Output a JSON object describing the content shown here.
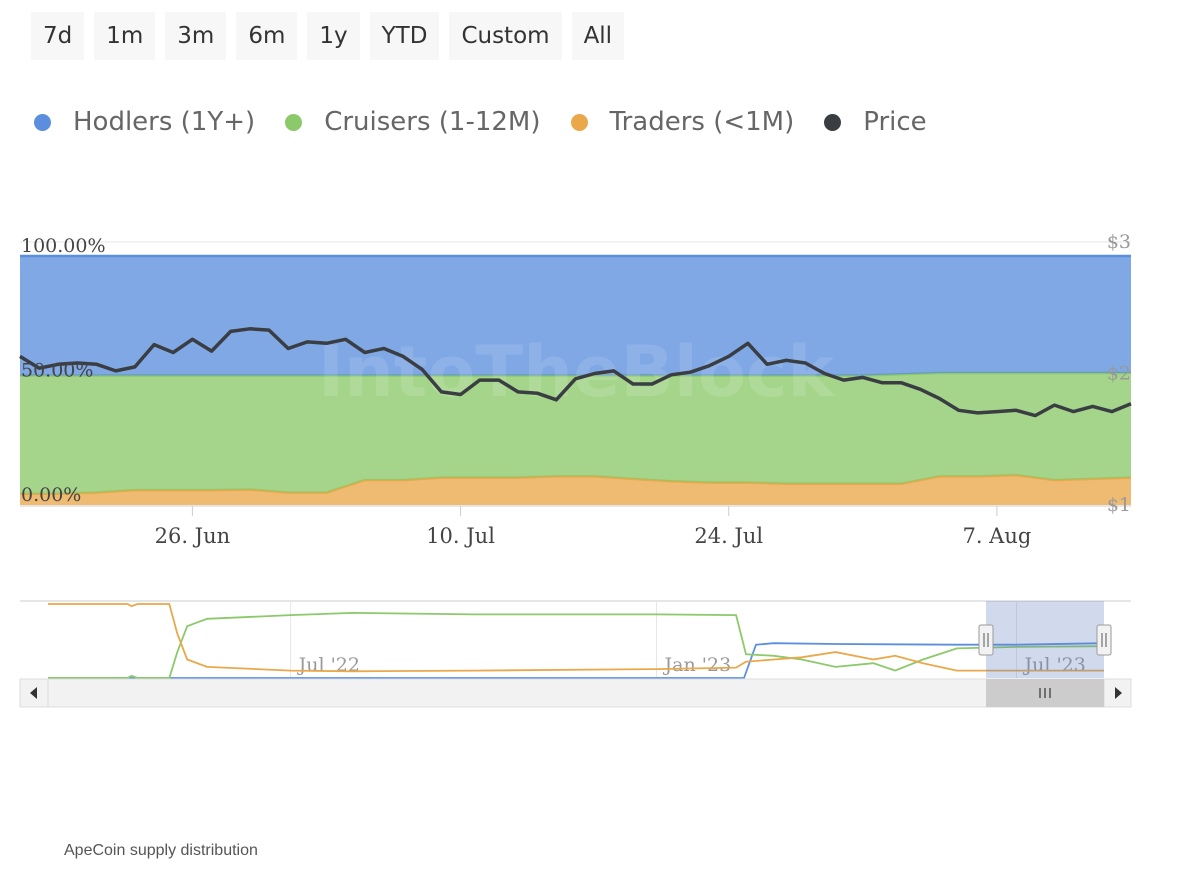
{
  "range_selector": {
    "buttons": [
      "7d",
      "1m",
      "3m",
      "6m",
      "1y",
      "YTD",
      "Custom",
      "All"
    ]
  },
  "legend": [
    {
      "label": "Hodlers (1Y+)",
      "color": "#5b8fde"
    },
    {
      "label": "Cruisers (1-12M)",
      "color": "#8cc96a"
    },
    {
      "label": "Traders (<1M)",
      "color": "#eaa84a"
    },
    {
      "label": "Price",
      "color": "#3a3d42"
    }
  ],
  "caption": "ApeCoin supply distribution",
  "chart_data": {
    "type": "area",
    "stacked_percent": true,
    "x": [
      "2023-06-17",
      "2023-06-19",
      "2023-06-21",
      "2023-06-23",
      "2023-06-25",
      "2023-06-27",
      "2023-06-29",
      "2023-07-01",
      "2023-07-03",
      "2023-07-05",
      "2023-07-07",
      "2023-07-09",
      "2023-07-11",
      "2023-07-13",
      "2023-07-15",
      "2023-07-17",
      "2023-07-19",
      "2023-07-21",
      "2023-07-23",
      "2023-07-25",
      "2023-07-27",
      "2023-07-29",
      "2023-07-31",
      "2023-08-02",
      "2023-08-04",
      "2023-08-06",
      "2023-08-08",
      "2023-08-10",
      "2023-08-12",
      "2023-08-14"
    ],
    "series": [
      {
        "name": "Traders (<1M)",
        "values": [
          4.5,
          4.5,
          5,
          6,
          6,
          6,
          6.2,
          5,
          5,
          10,
          10,
          11,
          11,
          11,
          11.5,
          11.5,
          10.5,
          9.5,
          9,
          9,
          8.5,
          8.5,
          8.5,
          8.5,
          11.5,
          11.5,
          12,
          10,
          10.5,
          11
        ]
      },
      {
        "name": "Cruisers (1-12M)",
        "values": [
          47.5,
          47.5,
          47,
          46,
          46,
          46,
          45.8,
          47,
          47,
          42,
          42,
          41,
          41,
          41,
          40.5,
          40.5,
          41.5,
          42.5,
          43,
          43,
          43.5,
          43.5,
          43.5,
          44,
          41.5,
          41.5,
          41,
          43,
          42.5,
          42
        ]
      },
      {
        "name": "Hodlers (1Y+)",
        "values": [
          48,
          48,
          48,
          48,
          48,
          48,
          48,
          48,
          48,
          48,
          48,
          48,
          48,
          48,
          48,
          48,
          48,
          48,
          48,
          48,
          48,
          48,
          48,
          47.5,
          47,
          47,
          47,
          47,
          47,
          47
        ]
      }
    ],
    "price": {
      "name": "Price",
      "x": [
        "2023-06-17",
        "2023-06-18",
        "2023-06-19",
        "2023-06-20",
        "2023-06-21",
        "2023-06-22",
        "2023-06-23",
        "2023-06-24",
        "2023-06-25",
        "2023-06-26",
        "2023-06-27",
        "2023-06-28",
        "2023-06-29",
        "2023-06-30",
        "2023-07-01",
        "2023-07-02",
        "2023-07-03",
        "2023-07-04",
        "2023-07-05",
        "2023-07-06",
        "2023-07-07",
        "2023-07-08",
        "2023-07-09",
        "2023-07-10",
        "2023-07-11",
        "2023-07-12",
        "2023-07-13",
        "2023-07-14",
        "2023-07-15",
        "2023-07-16",
        "2023-07-17",
        "2023-07-18",
        "2023-07-19",
        "2023-07-20",
        "2023-07-21",
        "2023-07-22",
        "2023-07-23",
        "2023-07-24",
        "2023-07-25",
        "2023-07-26",
        "2023-07-27",
        "2023-07-28",
        "2023-07-29",
        "2023-07-30",
        "2023-07-31",
        "2023-08-01",
        "2023-08-02",
        "2023-08-03",
        "2023-08-04",
        "2023-08-05",
        "2023-08-06",
        "2023-08-07",
        "2023-08-08",
        "2023-08-09",
        "2023-08-10",
        "2023-08-11",
        "2023-08-12",
        "2023-08-13",
        "2023-08-14"
      ],
      "values": [
        2.13,
        2.04,
        2.07,
        2.08,
        2.07,
        2.02,
        2.05,
        2.22,
        2.16,
        2.26,
        2.17,
        2.32,
        2.34,
        2.33,
        2.19,
        2.24,
        2.23,
        2.26,
        2.16,
        2.19,
        2.13,
        2.03,
        1.86,
        1.84,
        1.95,
        1.95,
        1.86,
        1.85,
        1.8,
        1.96,
        2.0,
        2.02,
        1.92,
        1.92,
        1.99,
        2.01,
        2.06,
        2.13,
        2.23,
        2.07,
        2.1,
        2.08,
        2.0,
        1.95,
        1.97,
        1.93,
        1.93,
        1.88,
        1.81,
        1.72,
        1.7,
        1.71,
        1.72,
        1.68,
        1.76,
        1.71,
        1.75,
        1.71,
        1.77,
        1.8,
        1.94,
        1.93,
        1.98
      ]
    },
    "x_ticks": [
      "26. Jun",
      "10. Jul",
      "24. Jul",
      "7. Aug"
    ],
    "y_left_ticks": [
      "0.00%",
      "50.00%",
      "100.00%"
    ],
    "y_right_ticks": [
      "$1",
      "$2",
      "$3"
    ],
    "ylim_left": [
      0,
      100
    ],
    "ylim_right": [
      1,
      3
    ],
    "watermark": "IntoTheBlock",
    "navigator": {
      "labels": [
        "Jul '22",
        "Jan '23",
        "Jul '23"
      ],
      "x_range": [
        "2022-03-01",
        "2023-08-14"
      ],
      "selection": [
        "2023-06-17",
        "2023-08-14"
      ],
      "series": [
        {
          "name": "Hodlers (1Y+)",
          "x": [
            "2022-03-01",
            "2022-04-15",
            "2023-02-10",
            "2023-02-14",
            "2023-02-20",
            "2023-03-01",
            "2023-04-01",
            "2023-06-01",
            "2023-07-01",
            "2023-08-14"
          ],
          "values": [
            0,
            0,
            0,
            0,
            45,
            47,
            46,
            45,
            45,
            47
          ]
        },
        {
          "name": "Cruisers (1-12M)",
          "x": [
            "2022-03-01",
            "2022-04-10",
            "2022-04-12",
            "2022-04-15",
            "2022-05-01",
            "2022-05-05",
            "2022-05-10",
            "2022-05-20",
            "2022-07-01",
            "2022-08-01",
            "2022-10-01",
            "2023-01-01",
            "2023-02-10",
            "2023-02-15",
            "2023-03-01",
            "2023-03-15",
            "2023-04-01",
            "2023-04-20",
            "2023-05-01",
            "2023-05-15",
            "2023-06-01",
            "2023-07-01",
            "2023-08-14"
          ],
          "values": [
            0,
            0,
            3,
            0,
            0,
            35,
            70,
            80,
            85,
            88,
            86,
            86,
            85,
            32,
            30,
            25,
            15,
            20,
            10,
            25,
            40,
            42,
            43
          ]
        },
        {
          "name": "Traders (<1M)",
          "x": [
            "2022-03-01",
            "2022-04-01",
            "2022-04-10",
            "2022-04-12",
            "2022-04-15",
            "2022-05-01",
            "2022-05-05",
            "2022-05-10",
            "2022-05-20",
            "2022-07-01",
            "2022-08-01",
            "2022-10-01",
            "2023-01-01",
            "2023-02-10",
            "2023-02-15",
            "2023-03-01",
            "2023-03-15",
            "2023-04-01",
            "2023-04-20",
            "2023-05-01",
            "2023-05-15",
            "2023-06-01",
            "2023-07-01",
            "2023-08-14"
          ],
          "values": [
            100,
            100,
            100,
            97,
            100,
            100,
            60,
            25,
            15,
            10,
            9,
            10,
            12,
            14,
            22,
            25,
            28,
            35,
            25,
            30,
            20,
            10,
            10,
            10
          ]
        }
      ]
    }
  }
}
